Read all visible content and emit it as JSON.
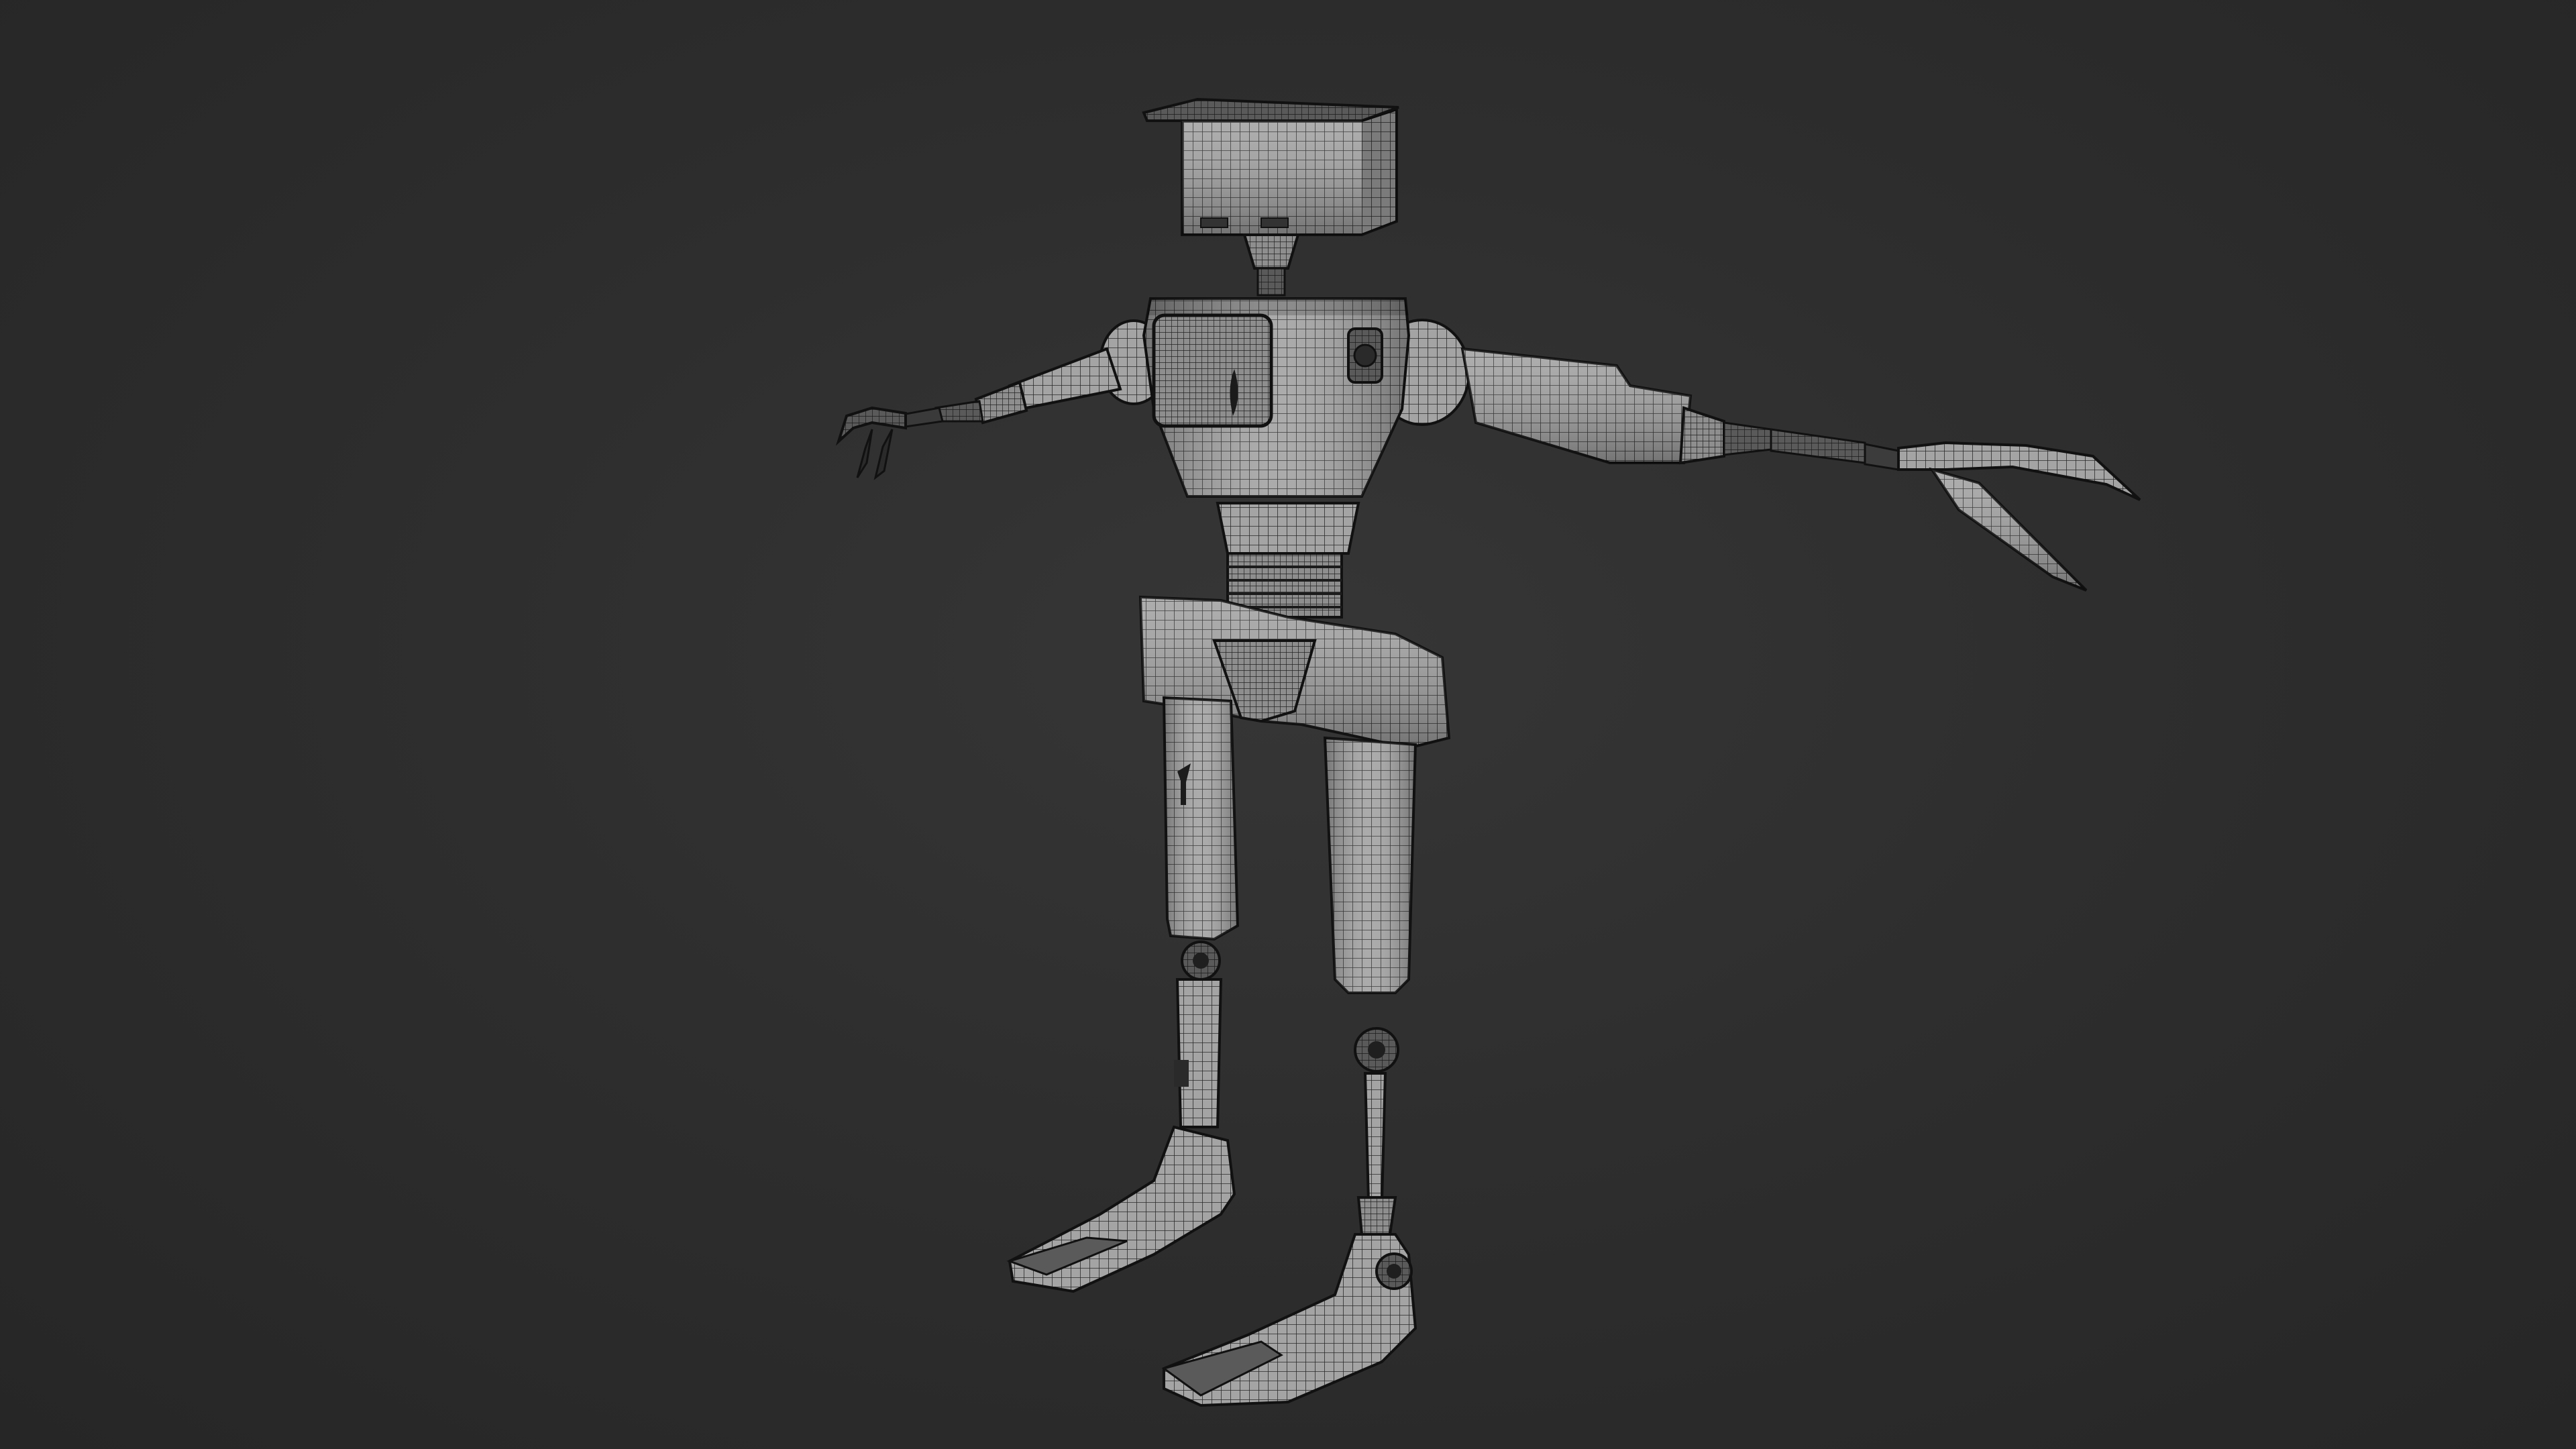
{
  "viewport": {
    "background_color": "#2e2e2e",
    "shading_mode": "wireframe-on-solid"
  },
  "model": {
    "subject": "robot",
    "pose": "T-pose",
    "surface_color": "#9a9a9a",
    "wire_color": "#1c1c1c",
    "parts": [
      "head-box",
      "neck",
      "torso",
      "chest-panel",
      "waist-coil",
      "pelvis",
      "left-arm",
      "right-arm",
      "left-claw",
      "right-claw",
      "left-leg",
      "right-leg",
      "left-knee-joint",
      "right-knee-joint",
      "left-foot",
      "right-foot"
    ]
  }
}
